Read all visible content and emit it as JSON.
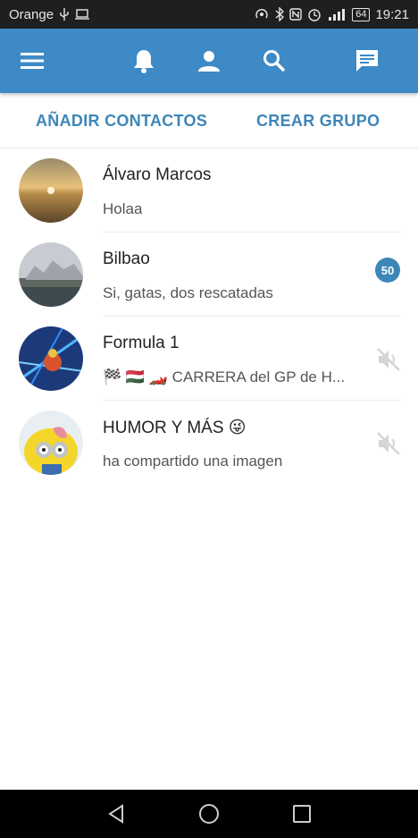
{
  "status_bar": {
    "carrier": "Orange",
    "battery": "64",
    "time": "19:21"
  },
  "app_bar": {
    "icons": [
      "menu-icon",
      "bell-icon",
      "person-icon",
      "search-icon",
      "chat-icon"
    ],
    "color": "#3d8ac7"
  },
  "actions": {
    "add_contacts": "AÑADIR CONTACTOS",
    "create_group": "CREAR GRUPO"
  },
  "chats": [
    {
      "name": "Álvaro Marcos",
      "message": "Holaa"
    },
    {
      "name": "Bilbao",
      "message": "Si, gatas, dos rescatadas",
      "unread": "50"
    },
    {
      "name": "Formula 1",
      "message": "🏁 🇭🇺 🏎️ CARRERA del GP de H...",
      "muted": true
    },
    {
      "name": "HUMOR Y MÁS 😜",
      "message": "ha compartido una imagen",
      "muted": true
    }
  ],
  "accent_color": "#3d86b8"
}
